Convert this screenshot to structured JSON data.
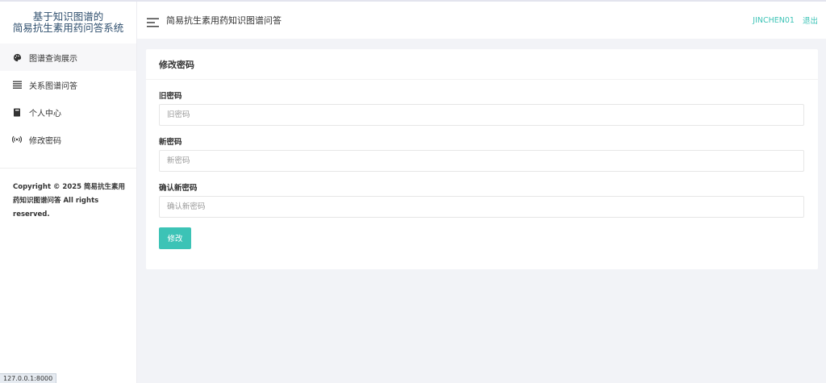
{
  "sidebar": {
    "brand_line1": "基于知识图谱的",
    "brand_line2": "简易抗生素用药问答系统",
    "items": [
      {
        "label": "图谱查询展示",
        "icon": "palette-icon"
      },
      {
        "label": "关系图谱问答",
        "icon": "list-icon"
      },
      {
        "label": "个人中心",
        "icon": "book-icon"
      },
      {
        "label": "修改密码",
        "icon": "broadcast-icon"
      }
    ],
    "copyright": "Copyright © 2025 简易抗生素用药知识图谱问答 All rights reserved."
  },
  "header": {
    "title": "简易抗生素用药知识图谱问答",
    "username": "JINCHEN01",
    "logout": "退出"
  },
  "card": {
    "title": "修改密码",
    "old_label": "旧密码",
    "old_placeholder": "旧密码",
    "new_label": "新密码",
    "new_placeholder": "新密码",
    "confirm_label": "确认新密码",
    "confirm_placeholder": "确认新密码",
    "submit_label": "修改"
  },
  "status_bar": {
    "url": "127.0.0.1:8000"
  },
  "colors": {
    "accent": "#3cc3b6",
    "brand": "#2f4f6e",
    "background": "#f2f3f7"
  }
}
